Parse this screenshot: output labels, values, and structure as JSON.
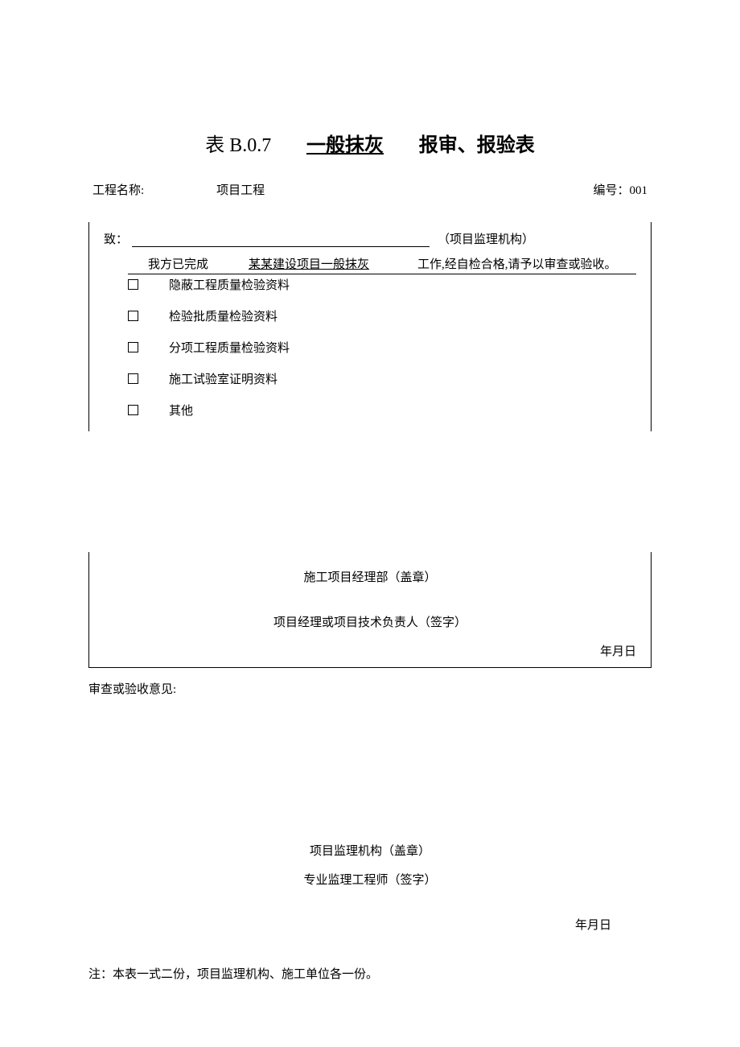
{
  "title": {
    "table_no": "表 B.0.7",
    "subject": "一般抹灰",
    "suffix": "报审、报验表"
  },
  "meta": {
    "project_label": "工程名称:",
    "project_value": "项目工程",
    "serial_label": "编号：",
    "serial_value": "001"
  },
  "body": {
    "to_label": "致：",
    "to_suffix": "（项目监理机构）",
    "declare_prefix": "我方已完成",
    "declare_item": "某某建设项目一般抹灰",
    "declare_suffix": "工作,经自检合格,请予以审查或验收。",
    "checks": [
      "隐蔽工程质量检验资料",
      "检验批质量检验资料",
      "分项工程质量检验资料",
      "施工试验室证明资料",
      "其他"
    ]
  },
  "sign1": {
    "dept": "施工项目经理部（盖章）",
    "person": "项目经理或项目技术负责人（签字）",
    "date": "年月日"
  },
  "review": {
    "label": "审查或验收意见:"
  },
  "sign2": {
    "dept": "项目监理机构（盖章）",
    "person": "专业监理工程师（签字）",
    "date": "年月日"
  },
  "note": "注：本表一式二份，项目监理机构、施工单位各一份。"
}
